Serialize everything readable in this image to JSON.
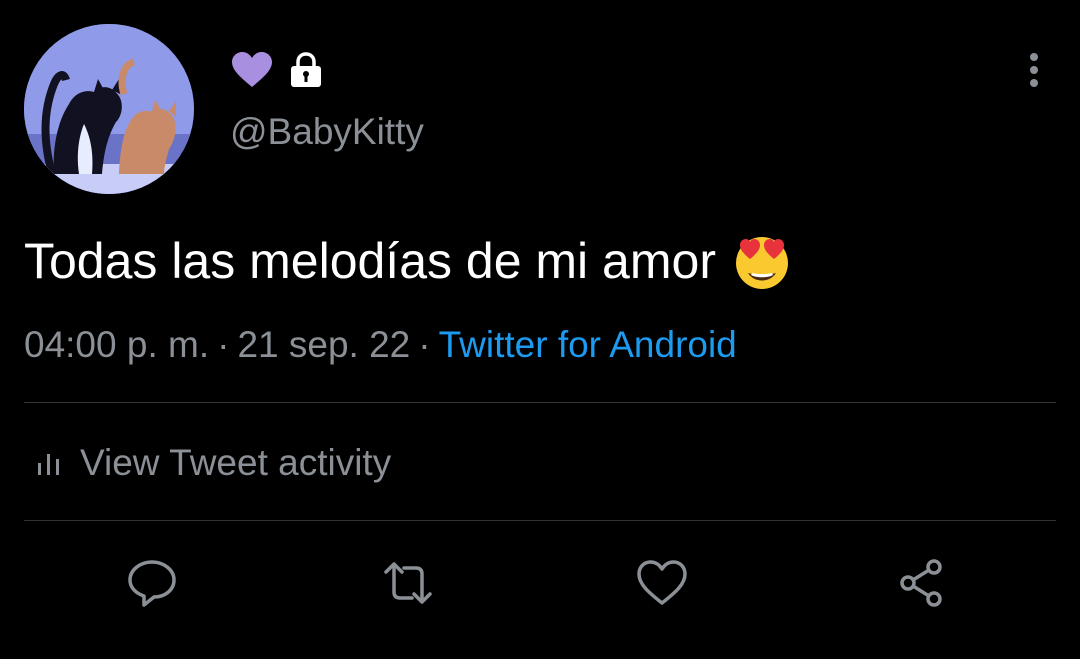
{
  "tweet": {
    "handle": "@BabyKitty",
    "text": "Todas las melodías de mi amor",
    "emoji": "smiling-face-with-heart-eyes",
    "time": "04:00 p. m.",
    "date": "21 sep. 22",
    "separator": "·",
    "source": "Twitter for Android"
  },
  "badges": {
    "heart_icon": "purple-heart-icon",
    "lock_icon": "lock-icon",
    "heart_color": "#a98fe0"
  },
  "activity": {
    "label": "View Tweet activity"
  },
  "actions": {
    "reply": "reply-icon",
    "retweet": "retweet-icon",
    "like": "like-icon",
    "share": "share-icon"
  },
  "colors": {
    "background": "#000000",
    "text": "#ffffff",
    "muted": "#8b9097",
    "link": "#1d9bf0",
    "divider": "#2f3336"
  }
}
